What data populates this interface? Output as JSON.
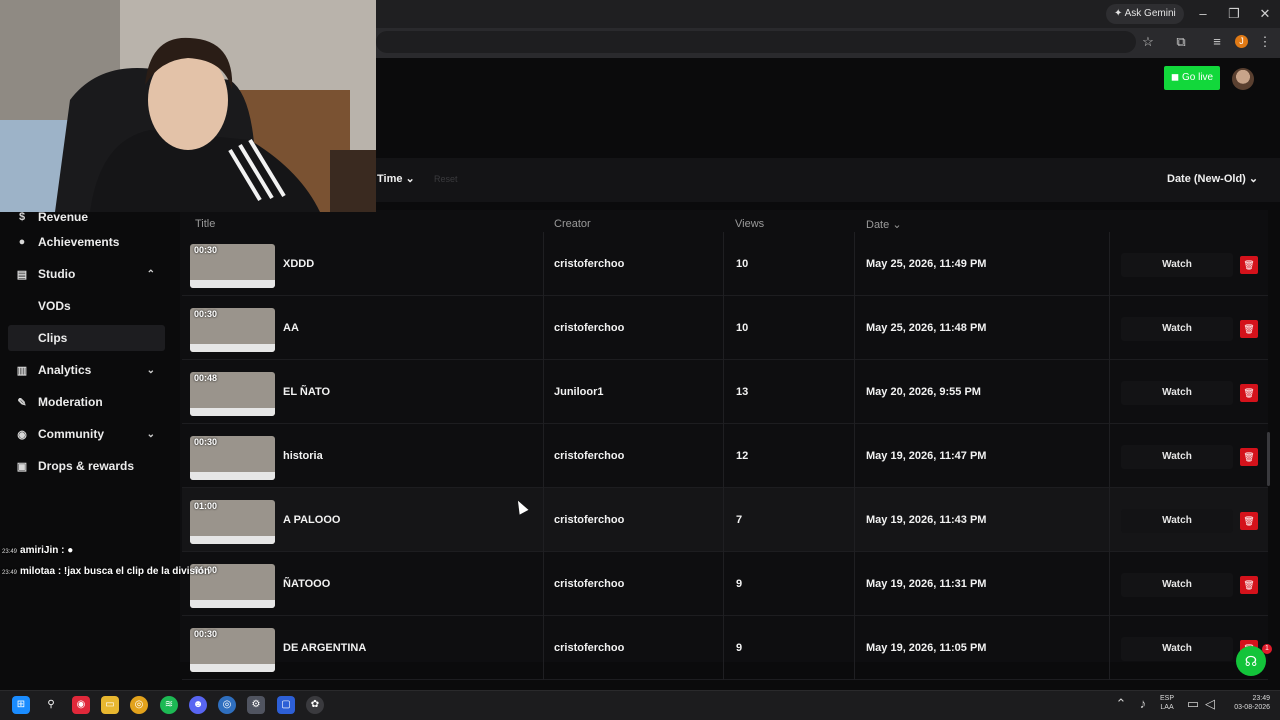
{
  "browser": {
    "ask_gemini": "Ask Gemini",
    "profile_initial": "J"
  },
  "header": {
    "go_live": "Go live"
  },
  "filters": {
    "time_label": "Time",
    "reset_label": "Reset",
    "sort_label": "Date (New-Old)"
  },
  "sidebar": {
    "items": [
      {
        "label": "Revenue",
        "icon": "revenue-icon"
      },
      {
        "label": "Achievements",
        "icon": "trophy-icon"
      },
      {
        "label": "Studio",
        "icon": "studio-icon"
      },
      {
        "label": "VODs"
      },
      {
        "label": "Clips"
      },
      {
        "label": "Analytics",
        "icon": "analytics-icon"
      },
      {
        "label": "Moderation",
        "icon": "wrench-icon"
      },
      {
        "label": "Community",
        "icon": "community-icon"
      },
      {
        "label": "Drops & rewards",
        "icon": "gift-icon"
      }
    ]
  },
  "chat": [
    {
      "time": "23:49",
      "user": "amiriJin",
      "message": ":"
    },
    {
      "time": "23:49",
      "user": "milotaa",
      "message": ": !jax busca el clip de la división"
    }
  ],
  "table": {
    "headers": {
      "title": "Title",
      "creator": "Creator",
      "views": "Views",
      "date": "Date"
    },
    "watch_label": "Watch",
    "rows": [
      {
        "duration": "00:30",
        "title": "XDDD",
        "creator": "cristoferchoo",
        "views": "10",
        "date": "May 25, 2026, 11:49 PM"
      },
      {
        "duration": "00:30",
        "title": "AA",
        "creator": "cristoferchoo",
        "views": "10",
        "date": "May 25, 2026, 11:48 PM"
      },
      {
        "duration": "00:48",
        "title": "EL ÑATO",
        "creator": "Juniloor1",
        "views": "13",
        "date": "May 20, 2026, 9:55 PM"
      },
      {
        "duration": "00:30",
        "title": "historia",
        "creator": "cristoferchoo",
        "views": "12",
        "date": "May 19, 2026, 11:47 PM"
      },
      {
        "duration": "01:00",
        "title": "A PALOOO",
        "creator": "cristoferchoo",
        "views": "7",
        "date": "May 19, 2026, 11:43 PM"
      },
      {
        "duration": "01:00",
        "title": "ÑATOOO",
        "creator": "cristoferchoo",
        "views": "9",
        "date": "May 19, 2026, 11:31 PM"
      },
      {
        "duration": "00:30",
        "title": "DE ARGENTINA",
        "creator": "cristoferchoo",
        "views": "9",
        "date": "May 19, 2026, 11:05 PM"
      }
    ]
  },
  "taskbar": {
    "lang_line1": "ESP",
    "lang_line2": "LAA",
    "time": "23:49",
    "date": "03-08-2026",
    "help_badge": "1"
  },
  "colors": {
    "accent_green": "#12d83b",
    "delete_red": "#d4121b"
  }
}
